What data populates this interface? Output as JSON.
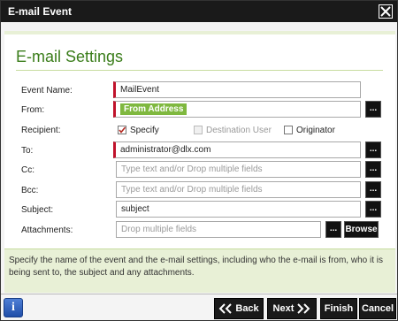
{
  "window": {
    "title": "E-mail Event"
  },
  "section": {
    "heading": "E-mail Settings"
  },
  "fields": {
    "event_name": {
      "label": "Event Name:",
      "value": "MailEvent"
    },
    "from": {
      "label": "From:",
      "chip": "From Address",
      "button": "..."
    },
    "recipient": {
      "label": "Recipient:",
      "options": [
        {
          "label": "Specify",
          "checked": true,
          "disabled": false
        },
        {
          "label": "Destination User",
          "checked": false,
          "disabled": true
        },
        {
          "label": "Originator",
          "checked": false,
          "disabled": false
        }
      ]
    },
    "to": {
      "label": "To:",
      "value": "administrator@dlx.com",
      "button": "..."
    },
    "cc": {
      "label": "Cc:",
      "placeholder": "Type text and/or Drop multiple fields",
      "button": "..."
    },
    "bcc": {
      "label": "Bcc:",
      "placeholder": "Type text and/or Drop multiple fields",
      "button": "..."
    },
    "subject": {
      "label": "Subject:",
      "value": "subject",
      "button": "..."
    },
    "attachments": {
      "label": "Attachments:",
      "placeholder": "Drop multiple fields",
      "button": "...",
      "browse": "Browse"
    }
  },
  "help": {
    "text": "Specify the name of the event and the e-mail settings, including who the e-mail is from, who it is being sent to, the subject and any attachments."
  },
  "footer": {
    "info": "i",
    "back": "Back",
    "next": "Next",
    "finish": "Finish",
    "cancel": "Cancel"
  },
  "colors": {
    "accent_green": "#3a7d1a",
    "required_red": "#c0122b",
    "chip_green": "#7fb83f",
    "help_bg": "#e8f0d6"
  }
}
